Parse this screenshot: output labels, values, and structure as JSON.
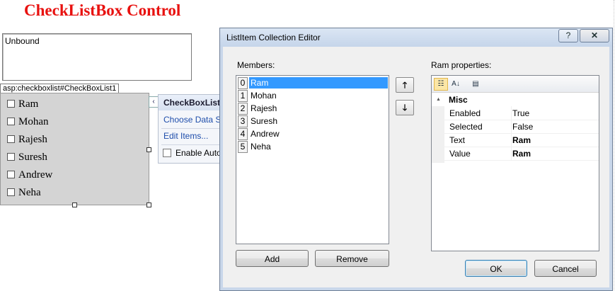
{
  "page": {
    "title": "CheckListBox Control",
    "textarea_value": "Unbound",
    "control_tag": "asp:checkboxlist#CheckBoxList1",
    "checklist_items": [
      "Ram",
      "Mohan",
      "Rajesh",
      "Suresh",
      "Andrew",
      "Neha"
    ]
  },
  "smart_tag": {
    "header": "CheckBoxList",
    "choose_data_source": "Choose Data So",
    "edit_items": "Edit Items...",
    "enable_autopostback": "Enable Auto"
  },
  "dialog": {
    "title": "ListItem Collection Editor",
    "help_label": "?",
    "close_label": "✕",
    "members_label": "Members:",
    "members": [
      {
        "index": "0",
        "name": "Ram"
      },
      {
        "index": "1",
        "name": "Mohan"
      },
      {
        "index": "2",
        "name": "Rajesh"
      },
      {
        "index": "3",
        "name": "Suresh"
      },
      {
        "index": "4",
        "name": "Andrew"
      },
      {
        "index": "5",
        "name": "Neha"
      }
    ],
    "selected_index": 0,
    "move_up": "🡑",
    "move_down": "🡓",
    "add_label": "Add",
    "remove_label": "Remove",
    "properties_label": "Ram properties:",
    "category": "Misc",
    "collapse_glyph": "▲",
    "properties": [
      {
        "key": "Enabled",
        "value": "True",
        "bold": false
      },
      {
        "key": "Selected",
        "value": "False",
        "bold": false
      },
      {
        "key": "Text",
        "value": "Ram",
        "bold": true
      },
      {
        "key": "Value",
        "value": "Ram",
        "bold": true
      }
    ],
    "ok_label": "OK",
    "cancel_label": "Cancel"
  },
  "icons": {
    "categorized": "categorized-view-icon",
    "alphabetical": "alphabetical-sort-icon",
    "property_pages": "property-pages-icon"
  }
}
